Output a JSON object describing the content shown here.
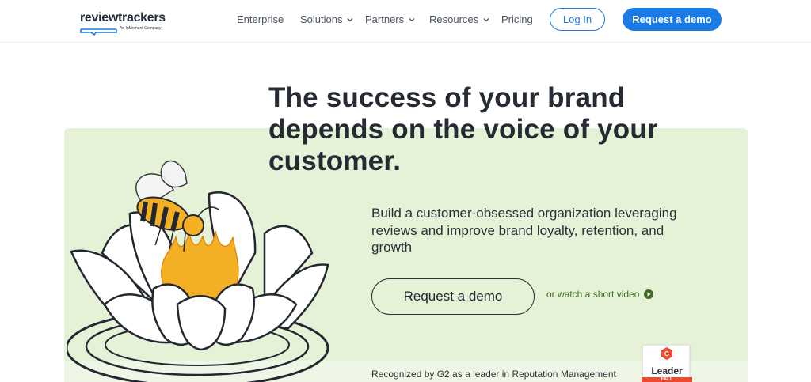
{
  "header": {
    "logo_text": "reviewtrackers",
    "logo_subtext": "An InMoment Company",
    "nav": [
      {
        "label": "Enterprise",
        "has_dropdown": false
      },
      {
        "label": "Solutions",
        "has_dropdown": true
      },
      {
        "label": "Partners",
        "has_dropdown": true
      },
      {
        "label": "Resources",
        "has_dropdown": true
      },
      {
        "label": "Pricing",
        "has_dropdown": false
      }
    ],
    "login_label": "Log In",
    "demo_label": "Request a demo"
  },
  "hero": {
    "headline": "The success of your brand depends on the voice of your customer.",
    "subhead": "Build a customer-obsessed organization leveraging reviews and improve brand loyalty, retention, and growth",
    "cta_label": "Request a demo",
    "video_link": "or watch a short video",
    "recognition": "Recognized by G2 as a leader in Reputation Management",
    "badge": {
      "title": "Leader",
      "season": "FALL"
    }
  },
  "colors": {
    "brand_blue": "#1a7ae6",
    "hero_green": "#e5f2d7",
    "link_green": "#3d6b1f",
    "bee_yellow": "#f3b024",
    "g2_red": "#ef4a30"
  },
  "icons": [
    "chevron-down-icon",
    "play-circle-icon",
    "g2-logo-icon",
    "bee-lotus-illustration"
  ]
}
